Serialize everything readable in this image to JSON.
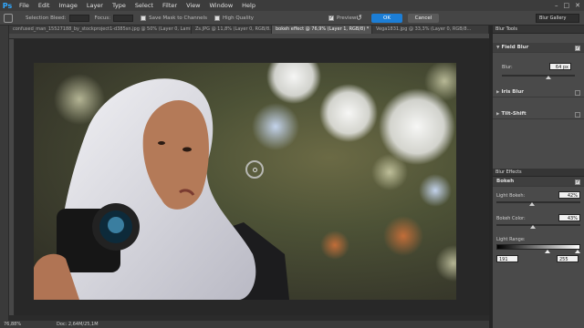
{
  "app": {
    "logo": "Ps"
  },
  "menu": [
    "File",
    "Edit",
    "Image",
    "Layer",
    "Type",
    "Select",
    "Filter",
    "View",
    "Window",
    "Help"
  ],
  "window_controls": {
    "minimize": "–",
    "maximize": "□",
    "close": "✕"
  },
  "options_bar": {
    "selection_bleed_label": "Selection Bleed:",
    "focus_label": "Focus:",
    "save_mask_label": "Save Mask to Channels",
    "high_quality_label": "High Quality",
    "preview_label": "Preview",
    "preview_checked": true,
    "ok_label": "OK",
    "cancel_label": "Cancel",
    "workspace": "Blur Gallery"
  },
  "tabs": [
    {
      "label": "confused_man_15527188_by_stockproject1-d385sn.jpg @ 50% (Layer 0, Lamb, Z, L...",
      "active": false
    },
    {
      "label": "Zs.JPG @ 11,8% (Layer 0, RGB/8...",
      "active": false
    },
    {
      "label": "bokeh effect @ 76,9% (Layer 1, RGB/8) *",
      "active": true
    },
    {
      "label": "Vega1831.jpg @ 33,3% (Layer 0, RGB/8...",
      "active": false
    }
  ],
  "status": {
    "zoom": "76,88%",
    "doc": "Doc: 2,64M/25,1M"
  },
  "blur_tools": {
    "header": "Blur Tools",
    "field_blur": {
      "label": "Field Blur",
      "enabled": true,
      "blur_label": "Blur:",
      "blur_value": "64 px",
      "blur_level": 0.64
    },
    "iris_blur": {
      "label": "Iris Blur",
      "enabled": false
    },
    "tilt_shift": {
      "label": "Tilt-Shift",
      "enabled": false
    }
  },
  "blur_effects": {
    "header": "Blur Effects",
    "bokeh": {
      "label": "Bokeh",
      "enabled": true
    },
    "light_bokeh": {
      "label": "Light Bokeh:",
      "value": "42%",
      "level": 0.42
    },
    "bokeh_color": {
      "label": "Bokeh Color:",
      "value": "43%",
      "level": 0.43
    },
    "light_range": {
      "label": "Light Range:",
      "low": "191",
      "high": "255"
    }
  },
  "icons": {
    "reset": "reset-icon",
    "pin": "blur-pin-icon"
  },
  "colors": {
    "accent": "#1c7ed6",
    "ps_blue": "#31a8ff"
  }
}
